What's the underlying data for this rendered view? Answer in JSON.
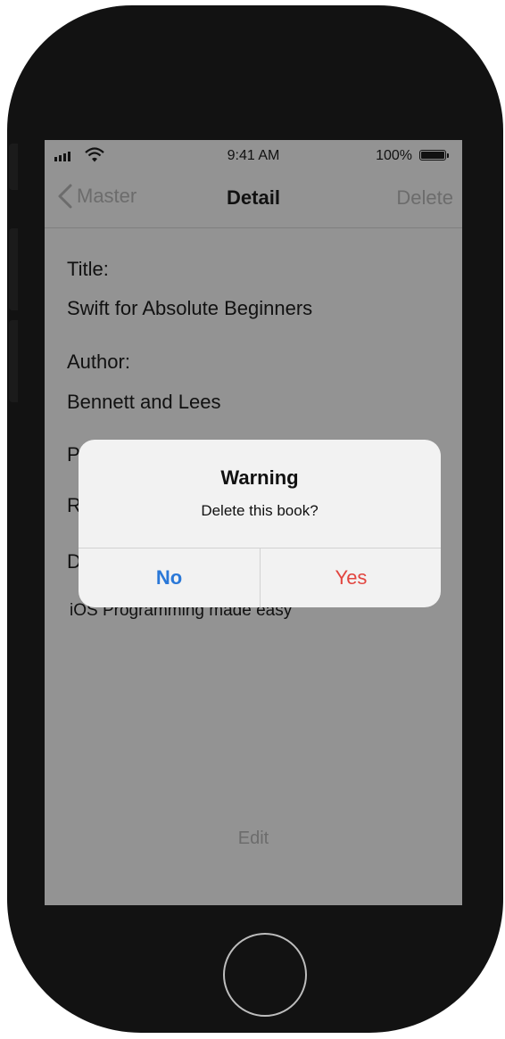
{
  "status_bar": {
    "time": "9:41 AM",
    "battery": "100%"
  },
  "nav": {
    "back_label": "Master",
    "title": "Detail",
    "action_label": "Delete"
  },
  "detail": {
    "title_label": "Title:",
    "title_value": "Swift for Absolute Beginners",
    "author_label": "Author:",
    "author_value": "Bennett and Lees",
    "field3_initial": "P",
    "field4_initial": "R",
    "field5_initial": "D",
    "description_value": "iOS Programming made easy"
  },
  "edit_label": "Edit",
  "alert": {
    "title": "Warning",
    "message": "Delete this book?",
    "cancel_label": "No",
    "confirm_label": "Yes"
  },
  "colors": {
    "dimmed_background": "#939393",
    "alert_background": "#f2f2f2",
    "cancel_blue": "#2a78d8",
    "destructive_red": "#e2453f"
  }
}
